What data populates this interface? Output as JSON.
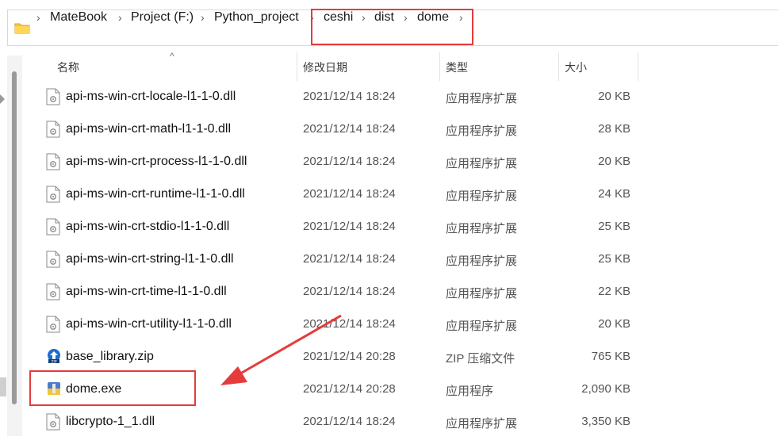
{
  "breadcrumb": {
    "items": [
      "MateBook",
      "Project (F:)",
      "Python_project",
      "ceshi",
      "dist",
      "dome"
    ],
    "separator": "›"
  },
  "columns": {
    "name": "名称",
    "date": "修改日期",
    "type": "类型",
    "size": "大小"
  },
  "files": [
    {
      "name": "api-ms-win-crt-locale-l1-1-0.dll",
      "date": "2021/12/14 18:24",
      "type": "应用程序扩展",
      "size": "20 KB",
      "icon": "dll-file-icon"
    },
    {
      "name": "api-ms-win-crt-math-l1-1-0.dll",
      "date": "2021/12/14 18:24",
      "type": "应用程序扩展",
      "size": "28 KB",
      "icon": "dll-file-icon"
    },
    {
      "name": "api-ms-win-crt-process-l1-1-0.dll",
      "date": "2021/12/14 18:24",
      "type": "应用程序扩展",
      "size": "20 KB",
      "icon": "dll-file-icon"
    },
    {
      "name": "api-ms-win-crt-runtime-l1-1-0.dll",
      "date": "2021/12/14 18:24",
      "type": "应用程序扩展",
      "size": "24 KB",
      "icon": "dll-file-icon"
    },
    {
      "name": "api-ms-win-crt-stdio-l1-1-0.dll",
      "date": "2021/12/14 18:24",
      "type": "应用程序扩展",
      "size": "25 KB",
      "icon": "dll-file-icon"
    },
    {
      "name": "api-ms-win-crt-string-l1-1-0.dll",
      "date": "2021/12/14 18:24",
      "type": "应用程序扩展",
      "size": "25 KB",
      "icon": "dll-file-icon"
    },
    {
      "name": "api-ms-win-crt-time-l1-1-0.dll",
      "date": "2021/12/14 18:24",
      "type": "应用程序扩展",
      "size": "22 KB",
      "icon": "dll-file-icon"
    },
    {
      "name": "api-ms-win-crt-utility-l1-1-0.dll",
      "date": "2021/12/14 18:24",
      "type": "应用程序扩展",
      "size": "20 KB",
      "icon": "dll-file-icon"
    },
    {
      "name": "base_library.zip",
      "date": "2021/12/14 20:28",
      "type": "ZIP 压缩文件",
      "size": "765 KB",
      "icon": "zip-file-icon"
    },
    {
      "name": "dome.exe",
      "date": "2021/12/14 20:28",
      "type": "应用程序",
      "size": "2,090 KB",
      "icon": "exe-file-icon"
    },
    {
      "name": "libcrypto-1_1.dll",
      "date": "2021/12/14 18:24",
      "type": "应用程序扩展",
      "size": "3,350 KB",
      "icon": "dll-file-icon"
    }
  ],
  "annotation_color": "#e53b3b"
}
